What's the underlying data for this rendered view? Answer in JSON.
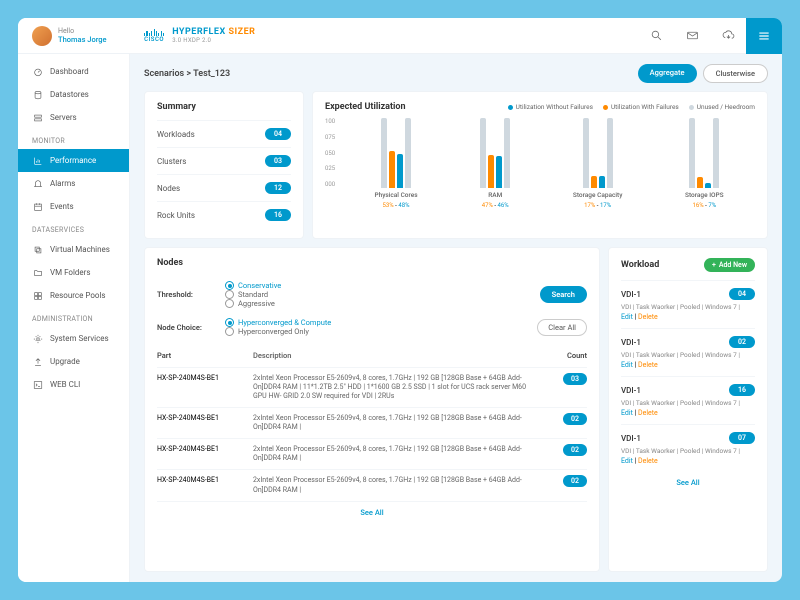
{
  "user": {
    "greeting": "Hello",
    "name": "Thomas Jorge"
  },
  "brand": {
    "cisco": "CISCO",
    "hyper": "HYPERFLEX",
    "sizer": "SIZER",
    "sub": "3.0 HXDP 2.0"
  },
  "nav": {
    "top": [
      {
        "label": "Dashboard"
      },
      {
        "label": "Datastores"
      },
      {
        "label": "Servers"
      }
    ],
    "monitor_header": "MONITOR",
    "monitor": [
      {
        "label": "Performance",
        "active": true
      },
      {
        "label": "Alarms"
      },
      {
        "label": "Events"
      }
    ],
    "dataservices_header": "DATASERVICES",
    "dataservices": [
      {
        "label": "Virtual Machines"
      },
      {
        "label": "VM Folders"
      },
      {
        "label": "Resource Pools"
      }
    ],
    "admin_header": "ADMINISTRATION",
    "admin": [
      {
        "label": "System Services"
      },
      {
        "label": "Upgrade"
      },
      {
        "label": "WEB CLI"
      }
    ]
  },
  "breadcrumb": "Scenarios > Test_123",
  "view_pills": {
    "aggregate": "Aggregate",
    "clusterwise": "Clusterwise"
  },
  "summary": {
    "title": "Summary",
    "rows": [
      {
        "label": "Workloads",
        "value": "04"
      },
      {
        "label": "Clusters",
        "value": "03"
      },
      {
        "label": "Nodes",
        "value": "12"
      },
      {
        "label": "Rock Units",
        "value": "16"
      }
    ]
  },
  "utilization": {
    "title": "Expected Utilization",
    "legend": {
      "without": "Utilization Without Failures",
      "with": "Utilization With Failures",
      "unused": "Unused / Heedroom"
    }
  },
  "chart_data": {
    "type": "bar",
    "ylim": [
      0,
      100
    ],
    "ticks": [
      "100",
      "075",
      "050",
      "025",
      "000"
    ],
    "categories": [
      "Physical Cores",
      "RAM",
      "Storage Capacity",
      "Storage IOPS"
    ],
    "series": [
      {
        "name": "Utilization With Failures",
        "color": "#ff8a00",
        "values": [
          53,
          47,
          17,
          16
        ]
      },
      {
        "name": "Utilization Without Failures",
        "color": "#0099cc",
        "values": [
          48,
          46,
          17,
          7
        ]
      }
    ],
    "labels": [
      {
        "o": "53%",
        "b": "48%"
      },
      {
        "o": "47%",
        "b": "46%"
      },
      {
        "o": "17%",
        "b": "17%"
      },
      {
        "o": "16%",
        "b": "7%"
      }
    ]
  },
  "nodes": {
    "title": "Nodes",
    "threshold_label": "Threshold:",
    "threshold_opts": [
      "Conservative",
      "Standard",
      "Aggressive"
    ],
    "choice_label": "Node Choice:",
    "choice_opts": [
      "Hyperconverged & Compute",
      "Hyperconverged Only"
    ],
    "search": "Search",
    "clear": "Clear All",
    "columns": {
      "part": "Part",
      "desc": "Description",
      "count": "Count"
    },
    "rows": [
      {
        "part": "HX-SP-240M4S-BE1",
        "desc": "2xIntel Xeon Processor E5-2609v4, 8 cores, 1.7GHz | 192 GB [128GB Base + 64GB Add-On]DDR4 RAM | 11*1.2TB 2.5\" HDD | 1*1600 GB 2.5 SSD | 1 slot for UCS rack server M60 GPU HW- GRID 2.0 SW required for VDI | 2RUs",
        "count": "03"
      },
      {
        "part": "HX-SP-240M4S-BE1",
        "desc": "2xIntel Xeon Processor E5-2609v4, 8 cores, 1.7GHz | 192 GB [128GB Base + 64GB Add-On]DDR4 RAM |",
        "count": "02"
      },
      {
        "part": "HX-SP-240M4S-BE1",
        "desc": "2xIntel Xeon Processor E5-2609v4, 8 cores, 1.7GHz | 192 GB [128GB Base + 64GB Add-On]DDR4 RAM |",
        "count": "02"
      },
      {
        "part": "HX-SP-240M4S-BE1",
        "desc": "2xIntel Xeon Processor E5-2609v4, 8 cores, 1.7GHz | 192 GB [128GB Base + 64GB Add-On]DDR4 RAM |",
        "count": "02"
      }
    ],
    "see_all": "See All"
  },
  "workload": {
    "title": "Workload",
    "add": "Add New",
    "items": [
      {
        "name": "VDI-1",
        "count": "04",
        "desc": "VDI | Task Waorker | Pooled | Windows 7 |"
      },
      {
        "name": "VDI-1",
        "count": "02",
        "desc": "VDI | Task Waorker | Pooled | Windows 7 |"
      },
      {
        "name": "VDI-1",
        "count": "16",
        "desc": "VDI | Task Waorker | Pooled | Windows 7 |"
      },
      {
        "name": "VDI-1",
        "count": "07",
        "desc": "VDI | Task Waorker | Pooled | Windows 7 |"
      }
    ],
    "edit": "Edit",
    "delete": "Delete",
    "see_all": "See All"
  }
}
